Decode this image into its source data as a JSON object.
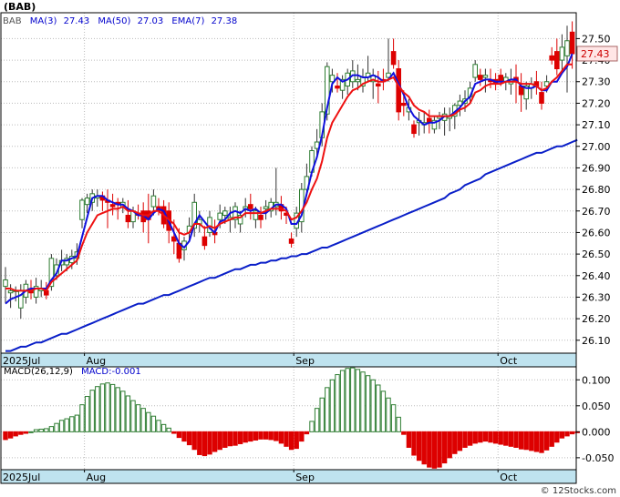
{
  "header": {
    "symbol": "(BAB)",
    "legend": [
      {
        "label": "BAB",
        "color": "#555555"
      },
      {
        "label": "MA(3)",
        "value": "27.43",
        "color": "#0000cc"
      },
      {
        "label": "MA(50)",
        "value": "27.03",
        "color": "#0000cc"
      },
      {
        "label": "EMA(7)",
        "value": "27.38",
        "color": "#0000cc"
      }
    ],
    "last_price_tag": "27.43"
  },
  "colors": {
    "up": "#2e7d32",
    "down": "#dd0000",
    "ma3": "#1010dd",
    "ma50": "#0a1fc8",
    "ema7": "#ee1111",
    "axis_band": "#bfe3ef",
    "grid": "#bbbbbb",
    "price_tag_bg": "#ffe6e6",
    "price_tag_fg": "#cc0000"
  },
  "macd": {
    "label": "MACD(26,12,9)",
    "value_label": "MACD:-0.001"
  },
  "watermark": "© 12Stocks.com",
  "chart_data": [
    {
      "type": "candlestick",
      "title": "(BAB)",
      "x_labels": [
        {
          "label": "2025Jul",
          "index": 0
        },
        {
          "label": "Aug",
          "index": 16
        },
        {
          "label": "Sep",
          "index": 57
        },
        {
          "label": "Oct",
          "index": 97
        }
      ],
      "yticks": [
        26.1,
        26.2,
        26.3,
        26.4,
        26.5,
        26.6,
        26.7,
        26.8,
        26.9,
        27.0,
        27.1,
        27.2,
        27.3,
        27.4,
        27.5
      ],
      "ylim": [
        26.04,
        27.62
      ],
      "grid": true,
      "ohlc": [
        [
          26.35,
          26.44,
          26.27,
          26.38
        ],
        [
          26.32,
          26.36,
          26.25,
          26.33
        ],
        [
          26.33,
          26.35,
          26.28,
          26.33
        ],
        [
          26.25,
          26.36,
          26.2,
          26.33
        ],
        [
          26.3,
          26.38,
          26.27,
          26.36
        ],
        [
          26.34,
          26.38,
          26.29,
          26.32
        ],
        [
          26.3,
          26.39,
          26.27,
          26.35
        ],
        [
          26.33,
          26.38,
          26.3,
          26.34
        ],
        [
          26.33,
          26.37,
          26.29,
          26.31
        ],
        [
          26.35,
          26.5,
          26.33,
          26.48
        ],
        [
          26.4,
          26.48,
          26.38,
          26.45
        ],
        [
          26.45,
          26.52,
          26.42,
          26.47
        ],
        [
          26.45,
          26.5,
          26.42,
          26.48
        ],
        [
          26.46,
          26.52,
          26.43,
          26.49
        ],
        [
          26.48,
          26.55,
          26.45,
          26.51
        ],
        [
          26.66,
          26.76,
          26.62,
          26.75
        ],
        [
          26.73,
          26.78,
          26.69,
          26.76
        ],
        [
          26.74,
          26.8,
          26.7,
          26.78
        ],
        [
          26.76,
          26.8,
          26.72,
          26.77
        ],
        [
          26.77,
          26.79,
          26.7,
          26.75
        ],
        [
          26.75,
          26.8,
          26.62,
          26.74
        ],
        [
          26.73,
          26.78,
          26.68,
          26.72
        ],
        [
          26.74,
          26.76,
          26.66,
          26.73
        ],
        [
          26.72,
          26.76,
          26.69,
          26.74
        ],
        [
          26.68,
          26.75,
          26.62,
          26.65
        ],
        [
          26.65,
          26.72,
          26.62,
          26.7
        ],
        [
          26.69,
          26.73,
          26.66,
          26.68
        ],
        [
          26.7,
          26.74,
          26.6,
          26.65
        ],
        [
          26.7,
          26.78,
          26.55,
          26.66
        ],
        [
          26.72,
          26.8,
          26.68,
          26.77
        ],
        [
          26.72,
          26.76,
          26.68,
          26.7
        ],
        [
          26.72,
          26.75,
          26.62,
          26.64
        ],
        [
          26.7,
          26.74,
          26.55,
          26.61
        ],
        [
          26.58,
          26.66,
          26.5,
          26.56
        ],
        [
          26.55,
          26.62,
          26.46,
          26.48
        ],
        [
          26.52,
          26.58,
          26.47,
          26.56
        ],
        [
          26.6,
          26.67,
          26.56,
          26.63
        ],
        [
          26.62,
          26.78,
          26.58,
          26.74
        ],
        [
          26.64,
          26.7,
          26.6,
          26.66
        ],
        [
          26.58,
          26.63,
          26.52,
          26.54
        ],
        [
          26.6,
          26.7,
          26.58,
          26.67
        ],
        [
          26.6,
          26.66,
          26.55,
          26.59
        ],
        [
          26.66,
          26.73,
          26.62,
          26.69
        ],
        [
          26.68,
          26.72,
          26.64,
          26.7
        ],
        [
          26.66,
          26.72,
          26.6,
          26.67
        ],
        [
          26.66,
          26.74,
          26.62,
          26.72
        ],
        [
          26.64,
          26.7,
          26.6,
          26.68
        ],
        [
          26.71,
          26.76,
          26.67,
          26.72
        ],
        [
          26.73,
          26.78,
          26.66,
          26.71
        ],
        [
          26.66,
          26.72,
          26.62,
          26.7
        ],
        [
          26.68,
          26.72,
          26.62,
          26.66
        ],
        [
          26.71,
          26.75,
          26.66,
          26.72
        ],
        [
          26.7,
          26.76,
          26.67,
          26.74
        ],
        [
          26.72,
          26.9,
          26.68,
          26.74
        ],
        [
          26.73,
          26.77,
          26.66,
          26.7
        ],
        [
          26.69,
          26.72,
          26.64,
          26.68
        ],
        [
          26.57,
          26.6,
          26.53,
          26.55
        ],
        [
          26.62,
          26.72,
          26.58,
          26.69
        ],
        [
          26.65,
          26.83,
          26.6,
          26.8
        ],
        [
          26.8,
          26.92,
          26.77,
          26.86
        ],
        [
          26.88,
          27.0,
          26.86,
          26.98
        ],
        [
          26.99,
          27.08,
          26.96,
          27.02
        ],
        [
          27.04,
          27.2,
          27.0,
          27.16
        ],
        [
          27.15,
          27.39,
          27.12,
          27.37
        ],
        [
          27.3,
          27.36,
          27.25,
          27.33
        ],
        [
          27.28,
          27.34,
          27.25,
          27.27
        ],
        [
          27.26,
          27.33,
          27.22,
          27.31
        ],
        [
          27.28,
          27.36,
          27.24,
          27.34
        ],
        [
          27.3,
          27.4,
          27.27,
          27.35
        ],
        [
          27.3,
          27.38,
          27.26,
          27.31
        ],
        [
          27.28,
          27.36,
          27.25,
          27.32
        ],
        [
          27.32,
          27.42,
          27.3,
          27.34
        ],
        [
          27.3,
          27.36,
          27.22,
          27.33
        ],
        [
          27.29,
          27.35,
          27.2,
          27.28
        ],
        [
          27.31,
          27.36,
          27.26,
          27.3
        ],
        [
          27.32,
          27.5,
          27.3,
          27.34
        ],
        [
          27.44,
          27.5,
          27.36,
          27.38
        ],
        [
          27.36,
          27.4,
          27.12,
          27.16
        ],
        [
          27.2,
          27.26,
          27.14,
          27.19
        ],
        [
          27.16,
          27.22,
          27.12,
          27.18
        ],
        [
          27.1,
          27.12,
          27.04,
          27.06
        ],
        [
          27.11,
          27.16,
          27.05,
          27.12
        ],
        [
          27.1,
          27.16,
          27.06,
          27.11
        ],
        [
          27.13,
          27.17,
          27.06,
          27.11
        ],
        [
          27.08,
          27.14,
          27.06,
          27.12
        ],
        [
          27.13,
          27.16,
          27.08,
          27.14
        ],
        [
          27.12,
          27.18,
          27.05,
          27.15
        ],
        [
          27.13,
          27.18,
          27.07,
          27.14
        ],
        [
          27.14,
          27.2,
          27.08,
          27.19
        ],
        [
          27.19,
          27.24,
          27.14,
          27.21
        ],
        [
          27.2,
          27.26,
          27.16,
          27.22
        ],
        [
          27.23,
          27.3,
          27.2,
          27.27
        ],
        [
          27.32,
          27.4,
          27.3,
          27.38
        ],
        [
          27.33,
          27.36,
          27.28,
          27.31
        ],
        [
          27.32,
          27.36,
          27.25,
          27.33
        ],
        [
          27.31,
          27.36,
          27.27,
          27.3
        ],
        [
          27.31,
          27.34,
          27.26,
          27.29
        ],
        [
          27.33,
          27.36,
          27.28,
          27.3
        ],
        [
          27.3,
          27.34,
          27.26,
          27.32
        ],
        [
          27.29,
          27.36,
          27.24,
          27.31
        ],
        [
          27.32,
          27.38,
          27.2,
          27.3
        ],
        [
          27.28,
          27.34,
          27.16,
          27.24
        ],
        [
          27.22,
          27.3,
          27.17,
          27.28
        ],
        [
          27.27,
          27.32,
          27.22,
          27.29
        ],
        [
          27.3,
          27.35,
          27.24,
          27.28
        ],
        [
          27.25,
          27.3,
          27.17,
          27.2
        ],
        [
          27.28,
          27.33,
          27.25,
          27.3
        ],
        [
          27.42,
          27.46,
          27.38,
          27.4
        ],
        [
          27.44,
          27.5,
          27.33,
          27.36
        ],
        [
          27.4,
          27.52,
          27.34,
          27.46
        ],
        [
          27.42,
          27.56,
          27.25,
          27.49
        ],
        [
          27.53,
          27.58,
          27.36,
          27.43
        ]
      ],
      "series": [
        {
          "name": "MA(3)",
          "values": [
            26.27,
            26.29,
            26.3,
            26.31,
            26.33,
            26.34,
            26.34,
            26.34,
            26.34,
            26.38,
            26.41,
            26.47,
            26.47,
            26.48,
            26.49,
            26.58,
            26.67,
            26.76,
            26.77,
            26.77,
            26.75,
            26.74,
            26.73,
            26.73,
            26.71,
            26.7,
            26.68,
            26.68,
            26.66,
            26.69,
            26.71,
            26.7,
            26.65,
            26.6,
            26.55,
            26.53,
            26.56,
            26.64,
            26.68,
            26.65,
            26.62,
            26.6,
            26.65,
            26.66,
            26.69,
            26.7,
            26.69,
            26.71,
            26.7,
            26.71,
            26.69,
            26.69,
            26.71,
            26.73,
            26.73,
            26.71,
            26.64,
            26.64,
            26.68,
            26.78,
            26.88,
            26.95,
            27.05,
            27.18,
            27.29,
            27.32,
            27.3,
            27.31,
            27.33,
            27.33,
            27.32,
            27.32,
            27.33,
            27.32,
            27.3,
            27.31,
            27.34,
            27.29,
            27.24,
            27.18,
            27.14,
            27.12,
            27.1,
            27.11,
            27.11,
            27.12,
            27.14,
            27.14,
            27.16,
            27.18,
            27.21,
            27.23,
            27.29,
            27.3,
            27.31,
            27.31,
            27.3,
            27.3,
            27.3,
            27.31,
            27.31,
            27.28,
            27.27,
            27.27,
            27.28,
            27.26,
            27.26,
            27.3,
            27.3,
            27.34,
            27.37,
            27.43
          ]
        },
        {
          "name": "EMA(7)",
          "values": [
            26.34,
            26.34,
            26.33,
            26.33,
            26.33,
            26.33,
            26.34,
            26.34,
            26.33,
            26.37,
            26.39,
            26.41,
            26.43,
            26.45,
            26.47,
            26.54,
            26.6,
            26.64,
            26.68,
            26.69,
            26.7,
            26.71,
            26.71,
            26.72,
            26.7,
            26.7,
            26.69,
            26.68,
            26.68,
            26.7,
            26.7,
            26.68,
            26.66,
            26.64,
            26.6,
            26.59,
            26.6,
            26.64,
            26.64,
            26.62,
            26.63,
            26.62,
            26.64,
            26.65,
            26.66,
            26.67,
            26.67,
            26.69,
            26.69,
            26.69,
            26.69,
            26.7,
            26.71,
            26.71,
            26.71,
            26.7,
            26.66,
            26.67,
            26.7,
            26.74,
            26.8,
            26.85,
            26.93,
            27.04,
            27.11,
            27.15,
            27.19,
            27.23,
            27.26,
            27.27,
            27.29,
            27.3,
            27.31,
            27.3,
            27.3,
            27.31,
            27.32,
            27.28,
            27.25,
            27.23,
            27.19,
            27.17,
            27.16,
            27.14,
            27.14,
            27.14,
            27.14,
            27.14,
            27.15,
            27.17,
            27.18,
            27.2,
            27.25,
            27.26,
            27.28,
            27.29,
            27.29,
            27.29,
            27.3,
            27.3,
            27.3,
            27.29,
            27.29,
            27.29,
            27.28,
            27.26,
            27.27,
            27.3,
            27.32,
            27.35,
            27.38,
            27.38
          ]
        },
        {
          "name": "MA(50)",
          "values": [
            26.05,
            26.05,
            26.06,
            26.07,
            26.07,
            26.08,
            26.09,
            26.09,
            26.1,
            26.11,
            26.12,
            26.13,
            26.13,
            26.14,
            26.15,
            26.16,
            26.17,
            26.18,
            26.19,
            26.2,
            26.21,
            26.22,
            26.23,
            26.24,
            26.25,
            26.26,
            26.27,
            26.27,
            26.28,
            26.29,
            26.3,
            26.31,
            26.31,
            26.32,
            26.33,
            26.34,
            26.35,
            26.36,
            26.37,
            26.38,
            26.39,
            26.39,
            26.4,
            26.41,
            26.42,
            26.43,
            26.43,
            26.44,
            26.45,
            26.45,
            26.46,
            26.46,
            26.47,
            26.47,
            26.48,
            26.48,
            26.49,
            26.49,
            26.5,
            26.5,
            26.51,
            26.52,
            26.53,
            26.53,
            26.54,
            26.55,
            26.56,
            26.57,
            26.58,
            26.59,
            26.6,
            26.61,
            26.62,
            26.63,
            26.64,
            26.65,
            26.66,
            26.67,
            26.68,
            26.69,
            26.7,
            26.71,
            26.72,
            26.73,
            26.74,
            26.75,
            26.76,
            26.78,
            26.79,
            26.8,
            26.82,
            26.83,
            26.84,
            26.85,
            26.87,
            26.88,
            26.89,
            26.9,
            26.91,
            26.92,
            26.93,
            26.94,
            26.95,
            26.96,
            26.97,
            26.97,
            26.98,
            26.99,
            27.0,
            27.0,
            27.01,
            27.02,
            27.03
          ]
        }
      ]
    },
    {
      "type": "bar",
      "title": "MACD(26,12,9)",
      "yticks": [
        0.1,
        0.05,
        0.0,
        -0.05
      ],
      "ylim": [
        -0.073,
        0.125
      ],
      "grid": true,
      "values": [
        -0.015,
        -0.012,
        -0.008,
        -0.005,
        -0.003,
        0.0,
        0.004,
        0.005,
        0.006,
        0.01,
        0.016,
        0.022,
        0.025,
        0.029,
        0.032,
        0.052,
        0.068,
        0.08,
        0.087,
        0.092,
        0.094,
        0.091,
        0.085,
        0.078,
        0.069,
        0.06,
        0.052,
        0.045,
        0.037,
        0.03,
        0.022,
        0.014,
        0.007,
        -0.003,
        -0.011,
        -0.018,
        -0.025,
        -0.034,
        -0.044,
        -0.046,
        -0.043,
        -0.038,
        -0.034,
        -0.03,
        -0.027,
        -0.026,
        -0.023,
        -0.02,
        -0.018,
        -0.016,
        -0.014,
        -0.014,
        -0.015,
        -0.017,
        -0.022,
        -0.028,
        -0.034,
        -0.032,
        -0.018,
        -0.004,
        0.02,
        0.045,
        0.065,
        0.085,
        0.1,
        0.11,
        0.118,
        0.122,
        0.123,
        0.12,
        0.115,
        0.108,
        0.1,
        0.09,
        0.078,
        0.065,
        0.052,
        0.028,
        -0.005,
        -0.03,
        -0.045,
        -0.055,
        -0.062,
        -0.068,
        -0.07,
        -0.068,
        -0.06,
        -0.05,
        -0.042,
        -0.036,
        -0.03,
        -0.026,
        -0.022,
        -0.02,
        -0.018,
        -0.02,
        -0.022,
        -0.024,
        -0.026,
        -0.028,
        -0.03,
        -0.033,
        -0.034,
        -0.036,
        -0.038,
        -0.04,
        -0.035,
        -0.028,
        -0.02,
        -0.012,
        -0.008,
        -0.004,
        -0.001
      ]
    }
  ]
}
